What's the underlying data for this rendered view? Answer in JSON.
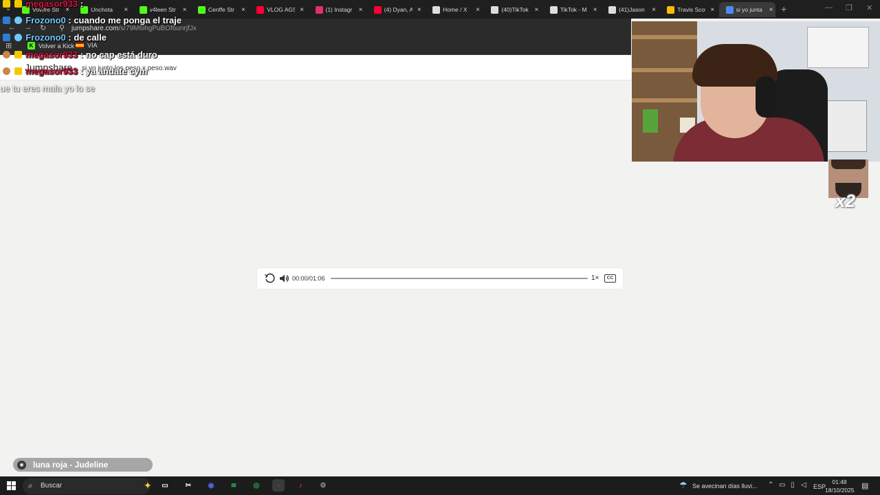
{
  "browser": {
    "tabs": [
      {
        "title": "Vovifre Str",
        "favicon": "kick-icon",
        "color": "#53fc18"
      },
      {
        "title": "Unchota",
        "favicon": "kick-icon",
        "color": "#53fc18"
      },
      {
        "title": "v4leen Str",
        "favicon": "kick-icon",
        "color": "#53fc18"
      },
      {
        "title": "Cenffe Str",
        "favicon": "kick-icon",
        "color": "#53fc18"
      },
      {
        "title": "VLOG AGS",
        "favicon": "youtube-icon",
        "color": "#ff0033"
      },
      {
        "title": "(1) Instagr",
        "favicon": "instagram-icon",
        "color": "#e1306c"
      },
      {
        "title": "(4) Dyan, A",
        "favicon": "youtube-icon",
        "color": "#ff0033"
      },
      {
        "title": "Home / X",
        "favicon": "x-icon",
        "color": "#dddddd"
      },
      {
        "title": "(40)TikTok",
        "favicon": "tiktok-icon",
        "color": "#dddddd"
      },
      {
        "title": "TikTok - M",
        "favicon": "tiktok-icon",
        "color": "#dddddd"
      },
      {
        "title": "(41)Jason",
        "favicon": "tiktok-icon",
        "color": "#dddddd"
      },
      {
        "title": "Travis Scot",
        "favicon": "google-icon",
        "color": "#fbbc05"
      },
      {
        "title": "si yo junta",
        "favicon": "jumpshare-icon",
        "color": "#4c8bf5",
        "active": true
      }
    ],
    "url_host": "jumpshare.com",
    "url_path": "/s/79M6lhgPuBOf6unrjfJx",
    "bookmarks": [
      {
        "label": "Volver a Kick"
      },
      {
        "label": "VIA"
      }
    ]
  },
  "page": {
    "brand": "Jumpshare",
    "file_name": "si yo junto los peso x peso.wav"
  },
  "player": {
    "current_time": "00:00",
    "duration": "01:06",
    "time_display": "00:00/01:06",
    "progress": 0,
    "speed": "1×",
    "cc_label": "CC"
  },
  "overlay": {
    "chat": [
      {
        "user": "megasor933",
        "message": ":",
        "user_color": "#d2143a"
      },
      {
        "user": "Frozono0",
        "message": ": cuando me ponga el traje",
        "user_color": "#6ec8ff"
      },
      {
        "user": "Frozono0",
        "message": ": de calle",
        "user_color": "#6ec8ff"
      },
      {
        "user": "megasor933",
        "message": ": no cap está duro",
        "user_color": "#d2143a"
      },
      {
        "user": "megasor933",
        "message": ": ya andate cym",
        "user_color": "#d2143a"
      }
    ],
    "lyric": "ue tu eres mala yo lo se",
    "multiplier": "x2",
    "now_playing": "luna roja - Judeline"
  },
  "taskbar": {
    "search_placeholder": "Buscar",
    "apps": [
      {
        "name": "task-view",
        "glyph": "▭"
      },
      {
        "name": "capcut",
        "glyph": "✂"
      },
      {
        "name": "discord",
        "glyph": "◉",
        "color": "#5865f2"
      },
      {
        "name": "spotify",
        "glyph": "≋",
        "color": "#1db954"
      },
      {
        "name": "chrome",
        "glyph": "◎",
        "color": "#34a853"
      },
      {
        "name": "obs",
        "glyph": "●",
        "color": "#444444"
      },
      {
        "name": "tiktok",
        "glyph": "♪",
        "color": "#fe2c55"
      },
      {
        "name": "steam",
        "glyph": "⚙",
        "color": "#8f98a0"
      }
    ],
    "weather": "Se avecinan días lluvi...",
    "language": "ESP",
    "time": "01:48",
    "date": "18/10/2025"
  }
}
